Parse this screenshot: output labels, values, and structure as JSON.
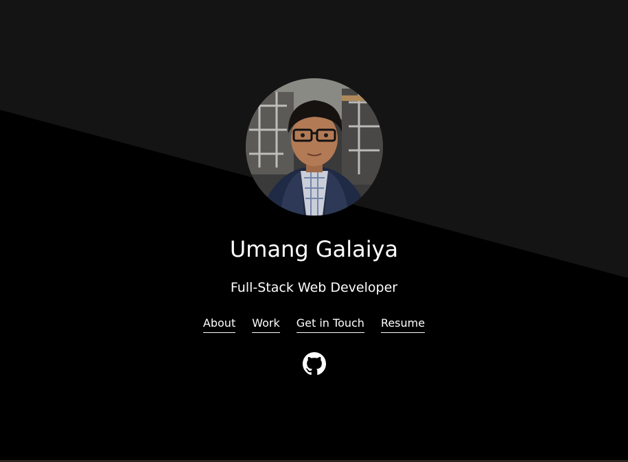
{
  "profile": {
    "name": "Umang Galaiya",
    "title": "Full-Stack Web Developer",
    "photo_alt": "Umang Galaiya"
  },
  "nav": {
    "items": [
      {
        "label": "About"
      },
      {
        "label": "Work"
      },
      {
        "label": "Get in Touch"
      },
      {
        "label": "Resume"
      }
    ]
  },
  "social": {
    "github_icon": "github-icon"
  },
  "colors": {
    "background": "#000000",
    "background_top": "#141414",
    "text": "#ffffff"
  }
}
